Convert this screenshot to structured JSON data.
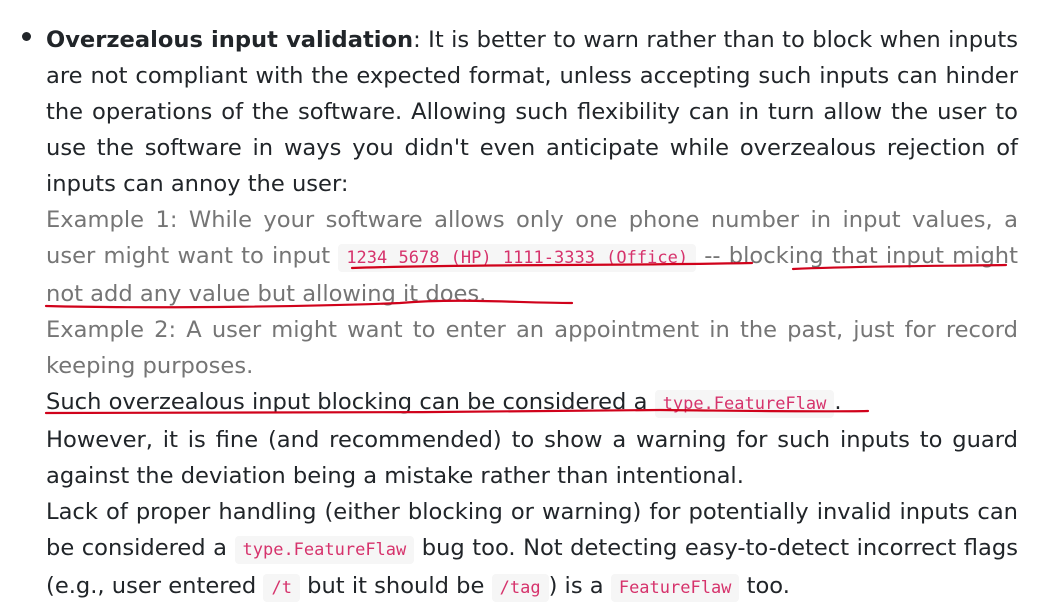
{
  "item": {
    "heading": "Overzealous input validation",
    "intro": ": It is better to warn rather than to block when inputs are not compliant with the expected format, unless accepting such inputs can hinder the operations of the software. Allowing such flexibility can in turn allow the user to use the software in ways you didn't even anticipate while overzealous rejection of inputs can annoy the user:",
    "example1_before": "Example 1: While your software allows only one phone number in input values, a user might want to input ",
    "example1_code": "1234 5678 (HP) 1111-3333 (Office)",
    "example1_after": " -- blocking that input might not add any value but allowing it does.",
    "example2": "Example 2: A user might want to enter an appointment in the past, just for record keeping purposes.",
    "conclusion_before": "Such overzealous input blocking can be considered a ",
    "conclusion_code": "type.FeatureFlaw",
    "conclusion_after": ".",
    "however": "However, it is fine (and recommended) to show a warning for such inputs to guard against the deviation being a mistake rather than intentional.",
    "lack_1": "Lack of proper handling (either blocking or warning) for potentially invalid inputs can be considered a ",
    "lack_code1": "type.FeatureFlaw",
    "lack_2": " bug too. Not detecting easy-to-detect incorrect flags (e.g., user entered ",
    "lack_code2": "/t",
    "lack_3": " but it should be ",
    "lack_code3": "/tag",
    "lack_4": ") is a ",
    "lack_code4": "FeatureFlaw",
    "lack_5": " too."
  },
  "annotation_color": "#d0021b"
}
